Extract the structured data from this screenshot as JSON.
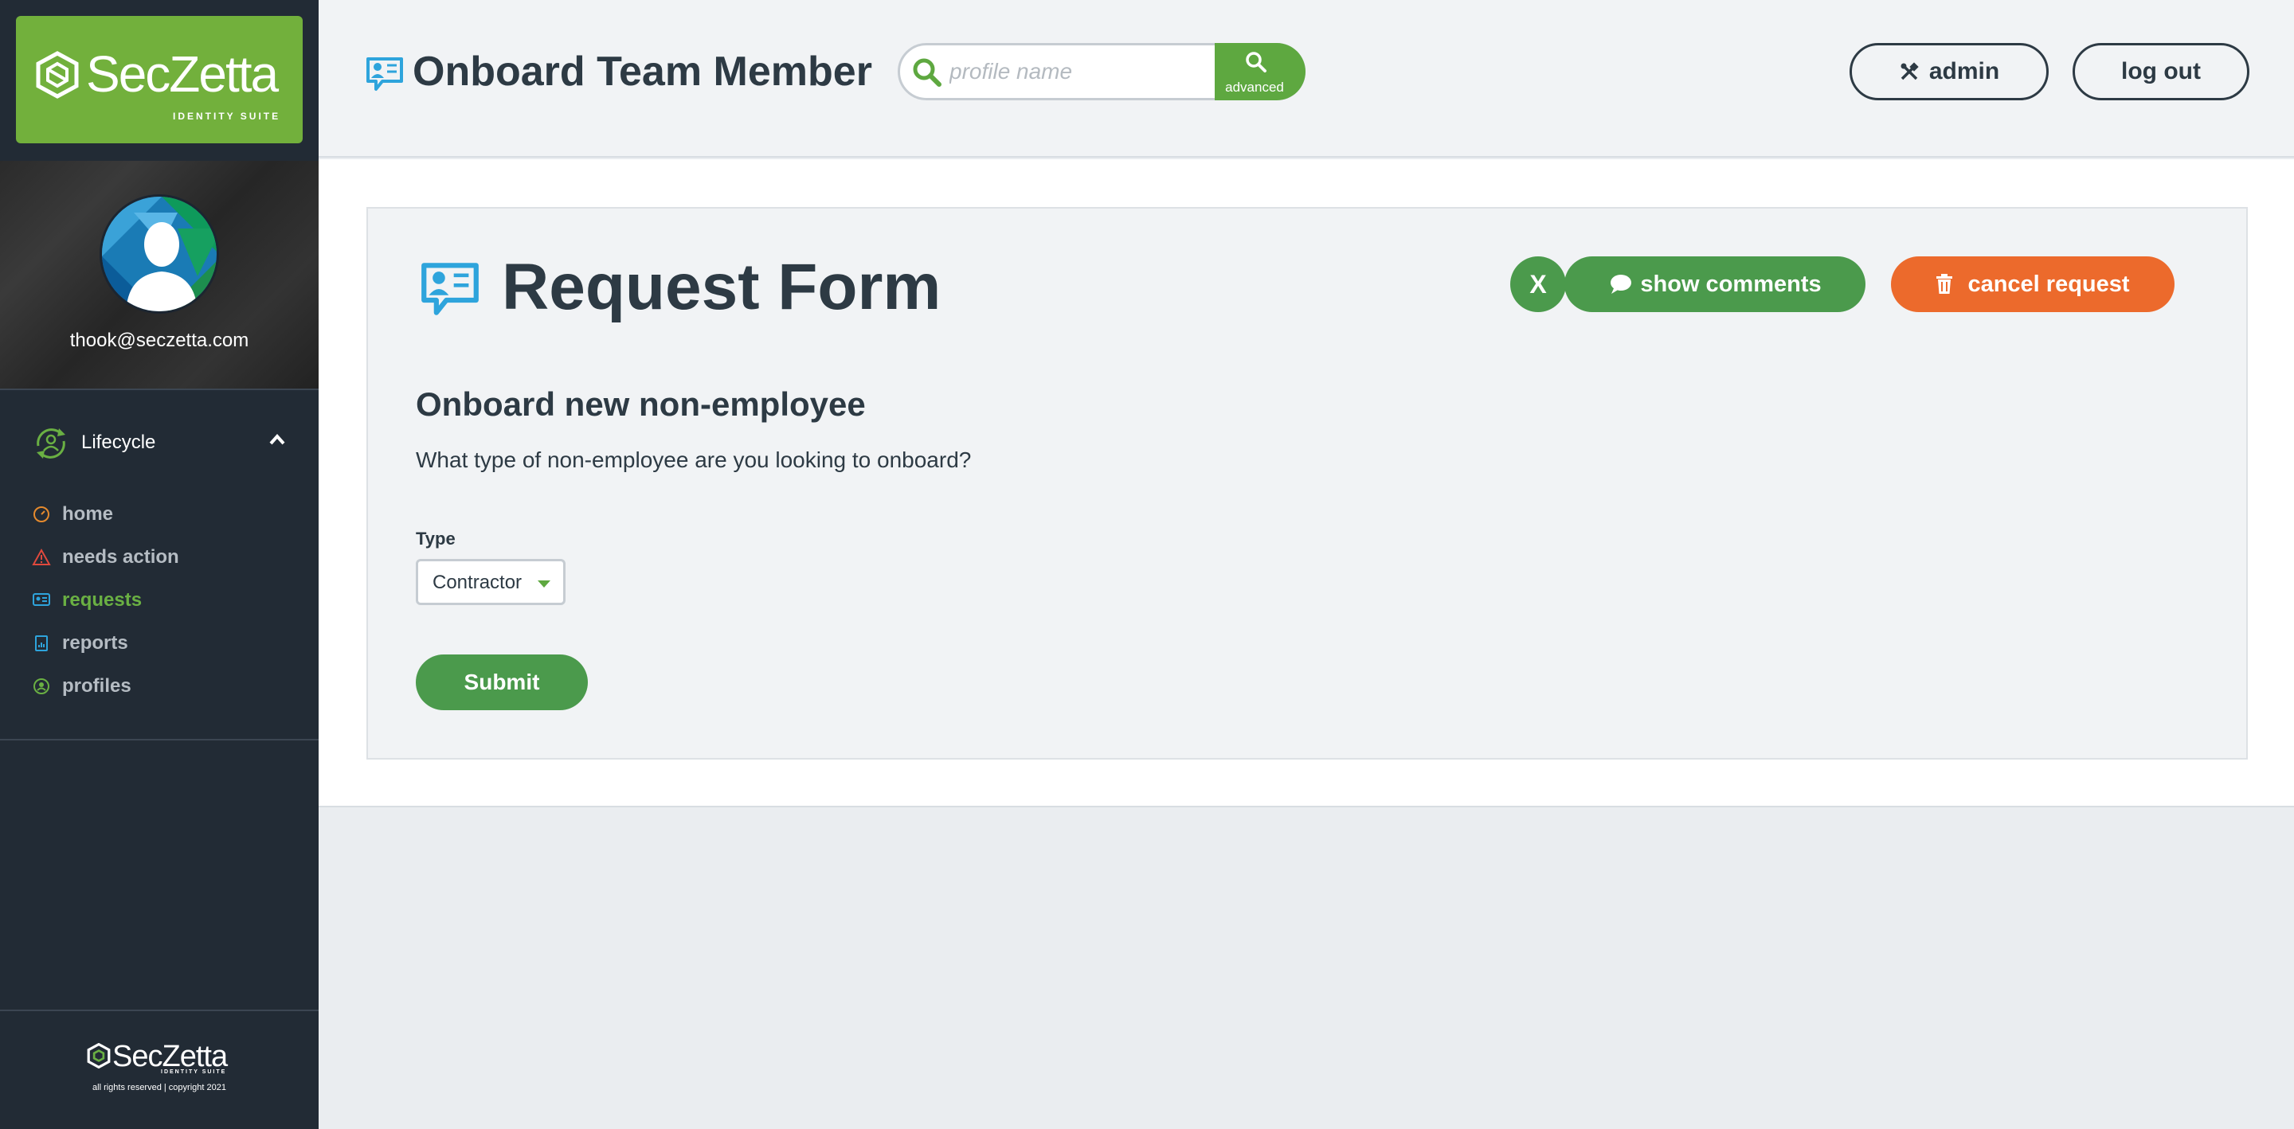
{
  "brand": {
    "logo_text": "SecZetta",
    "logo_sub": "IDENTITY SUITE",
    "accent": "#72b03c"
  },
  "user": {
    "email": "thook@seczetta.com"
  },
  "sidebar": {
    "section_label": "Lifecycle",
    "section_icon": "lifecycle-icon",
    "items": [
      {
        "label": "home",
        "icon": "dashboard-icon",
        "active": false
      },
      {
        "label": "needs action",
        "icon": "warning-icon",
        "active": false
      },
      {
        "label": "requests",
        "icon": "request-card-icon",
        "active": true
      },
      {
        "label": "reports",
        "icon": "report-icon",
        "active": false
      },
      {
        "label": "profiles",
        "icon": "profile-icon",
        "active": false
      }
    ],
    "footer_copyright": "all rights reserved | copyright 2021"
  },
  "header": {
    "title": "Onboard Team Member",
    "search_placeholder": "profile name",
    "advanced_label": "advanced",
    "admin_label": "admin",
    "logout_label": "log out"
  },
  "form": {
    "title": "Request Form",
    "close_label": "X",
    "show_comments_label": "show comments",
    "cancel_label": "cancel request",
    "section_title": "Onboard new non-employee",
    "question": "What type of non-employee are you looking to onboard?",
    "type_label": "Type",
    "type_value": "Contractor",
    "submit_label": "Submit"
  },
  "colors": {
    "primary_green": "#4b9a4c",
    "cancel_orange": "#ec6a2c",
    "sidebar_bg": "#222b35"
  }
}
